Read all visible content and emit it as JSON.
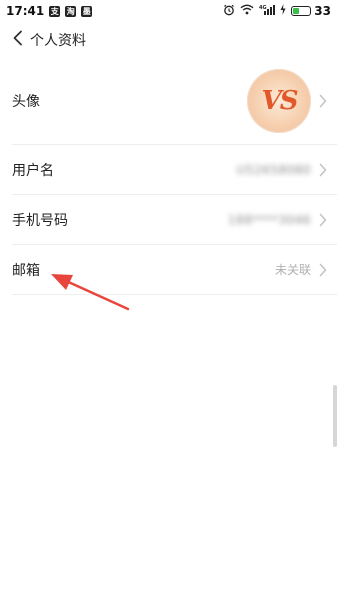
{
  "status_bar": {
    "time": "17:41",
    "battery": "33",
    "network": "4G",
    "app_icons": [
      "支",
      "淘",
      "墨"
    ]
  },
  "nav": {
    "title": "个人资料"
  },
  "rows": {
    "avatar": {
      "label": "头像",
      "avatar_text": "VS"
    },
    "username": {
      "label": "用户名",
      "value": "U52658080"
    },
    "phone": {
      "label": "手机号码",
      "value": "188****3046"
    },
    "email": {
      "label": "邮箱",
      "value": "未关联"
    }
  },
  "colors": {
    "annotation_arrow": "#e8453c",
    "chevron": "#c4c4c4",
    "value_text": "#b0b0b0",
    "battery_fill": "#3bbf4b"
  }
}
